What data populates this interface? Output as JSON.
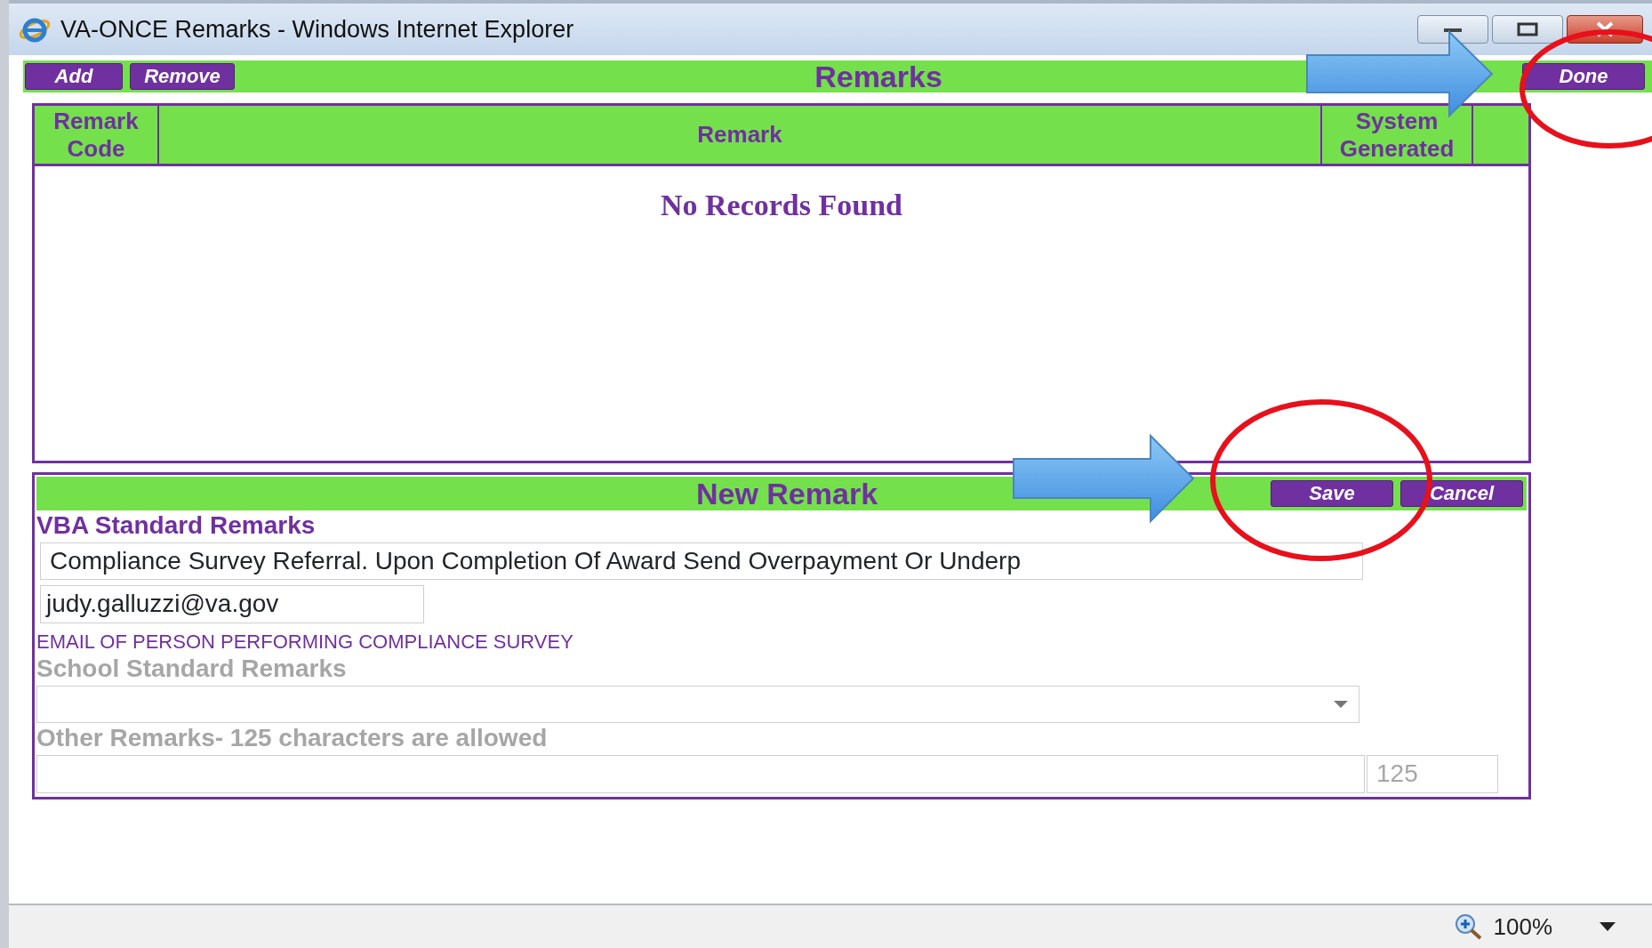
{
  "window": {
    "title": "VA-ONCE Remarks - Windows Internet Explorer"
  },
  "toolbar": {
    "buttons": [
      {
        "label": "Add"
      },
      {
        "label": "Remove"
      }
    ],
    "title": "Remarks",
    "done_button": "Done"
  },
  "table": {
    "columns": [
      "Remark Code",
      "Remark",
      "System Generated"
    ],
    "empty_message": "No Records Found"
  },
  "new_remark": {
    "title": "New Remark",
    "buttons": [
      {
        "label": "Save"
      },
      {
        "label": "Cancel"
      }
    ],
    "vba_label": "VBA Standard Remarks",
    "vba_value": "Compliance Survey Referral. Upon Completion Of Award Send Overpayment Or Underp",
    "email_value": "judy.galluzzi@va.gov",
    "email_caption": "EMAIL OF PERSON PERFORMING COMPLIANCE SURVEY",
    "school_label": "School Standard Remarks",
    "school_disabled": true,
    "other_label": "Other Remarks- 125 characters are allowed",
    "other_disabled": true,
    "counter": "125"
  },
  "status_bar": {
    "zoom": "100%"
  }
}
